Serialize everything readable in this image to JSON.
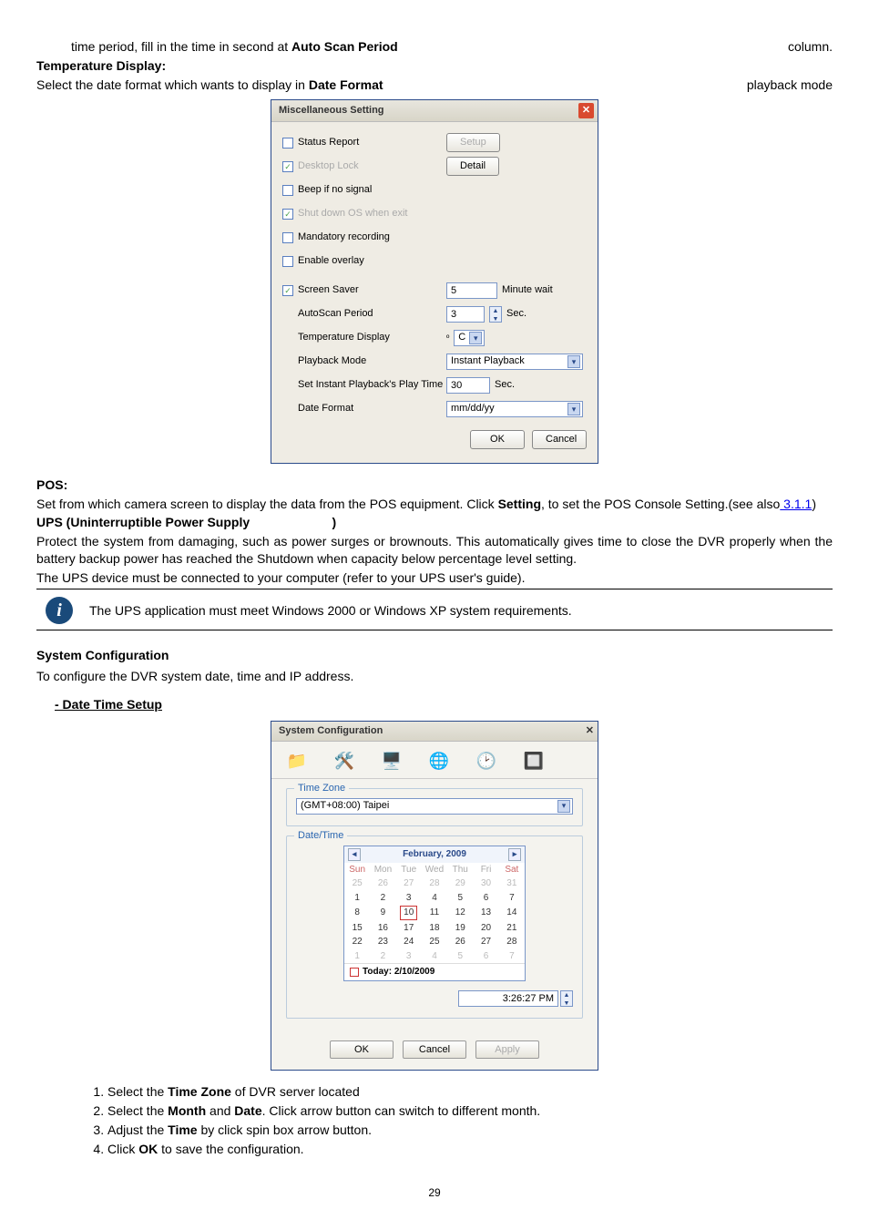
{
  "line_before": "time period, fill in the time in second at",
  "line_before_bold": "Auto Scan Period",
  "line_before_end": "column.",
  "temp_bold": "Temperature Display:",
  "dateformat_line_a": "Select the date format which wants to display in",
  "dateformat_bold": "Date Format",
  "dateformat_line_b": "playback mode",
  "misc": {
    "title": "Miscellaneous Setting",
    "status_report": "Status Report",
    "desktop_lock": "Desktop Lock",
    "beep": "Beep if no signal",
    "shutdown_exit": "Shut down OS when exit",
    "mandatory": "Mandatory recording",
    "enable_overlay": "Enable overlay",
    "screen_saver": "Screen Saver",
    "autoscan": "AutoScan Period",
    "temp_display": "Temperature Display",
    "playback_mode": "Playback Mode",
    "set_instant": "Set Instant Playback's Play Time",
    "date_format": "Date Format",
    "setup_btn": "Setup",
    "detail_btn": "Detail",
    "ss_val": "5",
    "minute_wait": "Minute wait",
    "autoscan_val": "3",
    "sec": "Sec.",
    "temp_prefix": "º",
    "temp_val": "C",
    "playback_val": "Instant Playback",
    "instant_val": "30",
    "dateformat_val": "mm/dd/yy",
    "ok": "OK",
    "cancel": "Cancel"
  },
  "pos_head": "POS:",
  "pos_line_a": "Set from which camera screen to display the data from the POS equipment. Click ",
  "pos_bold": "Setting",
  "pos_line_b": ", to set the POS Console Setting.(see also",
  "pos_link": " 3.1.1",
  "pos_close": ")",
  "ups_head": "UPS (Uninterruptible Power Supply",
  "ups_paren": ")",
  "ups_body": "Protect the system from damaging, such as power surges or brownouts. This automatically gives time to close the DVR properly when the battery backup power has reached the Shutdown when capacity below percentage level setting.",
  "ups_note": "The UPS device must be connected to your computer (refer to your UPS user's guide).",
  "ups_info": "The UPS application must meet Windows 2000 or Windows XP system requirements.",
  "system_heading": "System Configuration",
  "system_intro": "To configure the DVR system date, time and IP address.",
  "date_time_sub": "- Date Time Setup",
  "sys": {
    "title": "System Configuration",
    "tz_legend": "Time Zone",
    "tz_val": "(GMT+08:00) Taipei",
    "dt_legend": "Date/Time",
    "month_label": "February, 2009",
    "dow": [
      "Sun",
      "Mon",
      "Tue",
      "Wed",
      "Thu",
      "Fri",
      "Sat"
    ],
    "weeks": [
      [
        "25",
        "26",
        "27",
        "28",
        "29",
        "30",
        "31"
      ],
      [
        "1",
        "2",
        "3",
        "4",
        "5",
        "6",
        "7"
      ],
      [
        "8",
        "9",
        "10",
        "11",
        "12",
        "13",
        "14"
      ],
      [
        "15",
        "16",
        "17",
        "18",
        "19",
        "20",
        "21"
      ],
      [
        "22",
        "23",
        "24",
        "25",
        "26",
        "27",
        "28"
      ],
      [
        "1",
        "2",
        "3",
        "4",
        "5",
        "6",
        "7"
      ]
    ],
    "today_label": "Today: 2/10/2009",
    "time_val": "3:26:27 PM",
    "ok": "OK",
    "cancel": "Cancel",
    "apply": "Apply"
  },
  "steps": {
    "s1a": "Select the ",
    "s1b": "Time Zone",
    "s1c": " of DVR server located",
    "s2a": "Select the ",
    "s2b": "Month",
    "s2c": " and ",
    "s2d": "Date",
    "s2e": ". Click arrow button can switch to different month.",
    "s3a": "Adjust the ",
    "s3b": "Time",
    "s3c": " by click spin box arrow button.",
    "s4a": "Click ",
    "s4b": "OK",
    "s4c": " to save the configuration."
  },
  "page_number": "29"
}
